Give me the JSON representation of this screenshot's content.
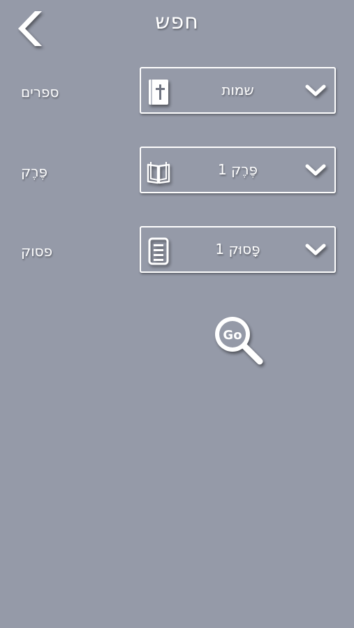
{
  "header": {
    "title": "חפש",
    "back_icon": "chevron-left-icon"
  },
  "fields": [
    {
      "label": "ספרים",
      "value": "שמות",
      "icon": "bible-book-icon",
      "dropdown_icon": "chevron-down-icon"
    },
    {
      "label": "פֶּרֶק",
      "value": "פֶּרֶק 1",
      "icon": "open-book-icon",
      "dropdown_icon": "chevron-down-icon"
    },
    {
      "label": "פסוק",
      "value": "פָּסוּק 1",
      "icon": "document-icon",
      "dropdown_icon": "chevron-down-icon"
    }
  ],
  "go_button": {
    "label": "Go",
    "icon": "magnifier-icon"
  },
  "colors": {
    "background": "#959aa8",
    "foreground": "#ffffff"
  }
}
